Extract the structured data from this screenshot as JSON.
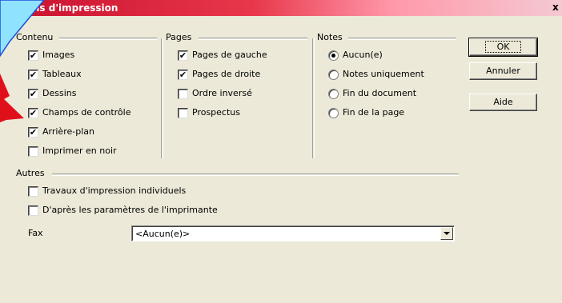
{
  "window": {
    "title": "Options d'impression",
    "close_glyph": "x"
  },
  "contenu": {
    "label": "Contenu",
    "items": [
      {
        "label": "Images",
        "checked": true
      },
      {
        "label": "Tableaux",
        "checked": true
      },
      {
        "label": "Dessins",
        "checked": true
      },
      {
        "label": "Champs de contrôle",
        "checked": true
      },
      {
        "label": "Arrière-plan",
        "checked": true
      },
      {
        "label": "Imprimer en noir",
        "checked": false
      }
    ]
  },
  "pages": {
    "label": "Pages",
    "items": [
      {
        "label": "Pages de gauche",
        "checked": true
      },
      {
        "label": "Pages de droite",
        "checked": true
      },
      {
        "label": "Ordre inversé",
        "checked": false
      },
      {
        "label": "Prospectus",
        "checked": false
      }
    ]
  },
  "notes": {
    "label": "Notes",
    "items": [
      {
        "label": "Aucun(e)",
        "selected": true
      },
      {
        "label": "Notes uniquement",
        "selected": false
      },
      {
        "label": "Fin du document",
        "selected": false
      },
      {
        "label": "Fin de la page",
        "selected": false
      }
    ]
  },
  "autres": {
    "label": "Autres",
    "items": [
      {
        "label": "Travaux d'impression individuels",
        "checked": false
      },
      {
        "label": "D'après les paramètres de l'imprimante",
        "checked": false
      }
    ],
    "fax_label": "Fax",
    "fax_value": "<Aucun(e)>"
  },
  "buttons": {
    "ok": "OK",
    "cancel": "Annuler",
    "help": "Aide"
  },
  "check_glyph": "✔",
  "colors": {
    "title_start": "#c8102e",
    "annotation": "#1e4fd8",
    "annotation_fill": "#8fe3ff",
    "arrow": "#e0101a"
  }
}
